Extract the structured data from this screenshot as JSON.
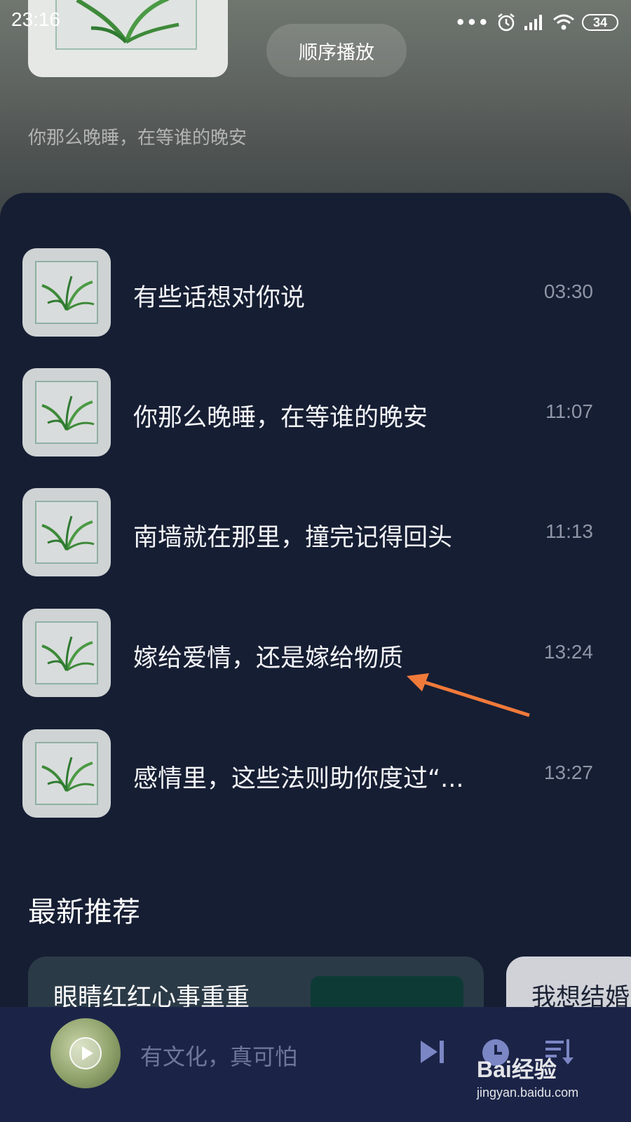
{
  "status_bar": {
    "time": "23:16",
    "battery": "34"
  },
  "header": {
    "order_button_label": "顺序播放",
    "subtitle": "你那么晚睡，在等谁的晚安"
  },
  "playlist": [
    {
      "title": "有些话想对你说",
      "duration": "03:30"
    },
    {
      "title": "你那么晚睡，在等谁的晚安",
      "duration": "11:07"
    },
    {
      "title": "南墙就在那里，撞完记得回头",
      "duration": "11:13"
    },
    {
      "title": "嫁给爱情，还是嫁给物质",
      "duration": "13:24"
    },
    {
      "title": "感情里，这些法则助你度过“...",
      "duration": "13:27"
    }
  ],
  "recommend": {
    "title": "最新推荐",
    "cards": [
      {
        "label": "眼睛红红心事重重"
      },
      {
        "label": "我想结婚"
      }
    ]
  },
  "player": {
    "now_playing": "有文化，真可怕"
  },
  "watermark": {
    "logo_text": "Bai经验",
    "url": "jingyan.baidu.com"
  },
  "colors": {
    "panel_bg": "#161e33",
    "player_bg": "#1b2447",
    "accent_icon": "#7b86c4",
    "annotation_arrow": "#f07a3a"
  }
}
